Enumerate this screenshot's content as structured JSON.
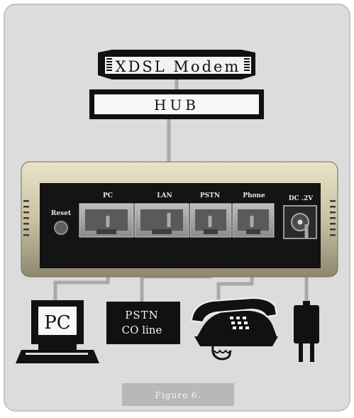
{
  "modem": {
    "label": "XDSL Modem"
  },
  "hub": {
    "label": "HUB"
  },
  "device": {
    "reset_label": "Reset",
    "ports": [
      {
        "label": "PC"
      },
      {
        "label": "LAN"
      },
      {
        "label": "PSTN"
      },
      {
        "label": "Phone"
      },
      {
        "label": "DC .2V"
      }
    ]
  },
  "endpoints": {
    "pc_label": "PC",
    "pstn_line1": "PSTN",
    "pstn_line2": "CO line"
  },
  "caption": "Figure 6.",
  "colors": {
    "panel_bg": "#dcdcdc",
    "panel_border": "#c4c4c4",
    "cable": "#a9a9a9",
    "device_shell": "#cfc7aa",
    "device_face": "#141414",
    "caption_bg": "#b8b8b8"
  },
  "icons": [
    "computer-icon",
    "telephone-icon",
    "power-adapter-icon"
  ]
}
